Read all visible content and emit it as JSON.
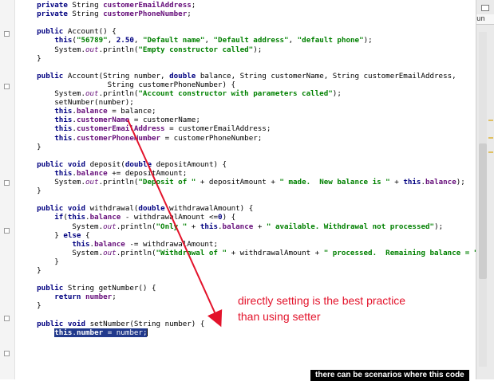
{
  "editor": {
    "lines": [
      [
        {
          "t": "    "
        },
        {
          "t": "private",
          "c": "k"
        },
        {
          "t": " String "
        },
        {
          "t": "customerEmailAddress",
          "c": "f"
        },
        {
          "t": ";"
        }
      ],
      [
        {
          "t": "    "
        },
        {
          "t": "private",
          "c": "k"
        },
        {
          "t": " String "
        },
        {
          "t": "customerPhoneNumber",
          "c": "f"
        },
        {
          "t": ";"
        }
      ],
      [],
      [
        {
          "t": "    "
        },
        {
          "t": "public",
          "c": "k"
        },
        {
          "t": " Account() {"
        }
      ],
      [
        {
          "t": "        "
        },
        {
          "t": "this",
          "c": "k"
        },
        {
          "t": "("
        },
        {
          "t": "\"56789\"",
          "c": "s"
        },
        {
          "t": ", "
        },
        {
          "t": "2.50",
          "c": "k"
        },
        {
          "t": ", "
        },
        {
          "t": "\"Default name\"",
          "c": "s"
        },
        {
          "t": ", "
        },
        {
          "t": "\"Default address\"",
          "c": "s"
        },
        {
          "t": ", "
        },
        {
          "t": "\"default phone\"",
          "c": "s"
        },
        {
          "t": ");"
        }
      ],
      [
        {
          "t": "        System."
        },
        {
          "t": "out",
          "c": "i"
        },
        {
          "t": ".println("
        },
        {
          "t": "\"Empty constructor called\"",
          "c": "s"
        },
        {
          "t": ");"
        }
      ],
      [
        {
          "t": "    }"
        }
      ],
      [],
      [
        {
          "t": "    "
        },
        {
          "t": "public",
          "c": "k"
        },
        {
          "t": " Account(String number, "
        },
        {
          "t": "double",
          "c": "k"
        },
        {
          "t": " balance, String customerName, String customerEmailAddress,"
        }
      ],
      [
        {
          "t": "                    String customerPhoneNumber) {"
        }
      ],
      [
        {
          "t": "        System."
        },
        {
          "t": "out",
          "c": "i"
        },
        {
          "t": ".println("
        },
        {
          "t": "\"Account constructor with parameters called\"",
          "c": "s"
        },
        {
          "t": ");"
        }
      ],
      [
        {
          "t": "        setNumber(number);"
        }
      ],
      [
        {
          "t": "        "
        },
        {
          "t": "this",
          "c": "k"
        },
        {
          "t": "."
        },
        {
          "t": "balance",
          "c": "f"
        },
        {
          "t": " = balance;"
        }
      ],
      [
        {
          "t": "        "
        },
        {
          "t": "this",
          "c": "k"
        },
        {
          "t": "."
        },
        {
          "t": "customerName",
          "c": "f"
        },
        {
          "t": " = customerName;"
        }
      ],
      [
        {
          "t": "        "
        },
        {
          "t": "this",
          "c": "k"
        },
        {
          "t": "."
        },
        {
          "t": "customerEmailAddress",
          "c": "f"
        },
        {
          "t": " = customerEmailAddress;"
        }
      ],
      [
        {
          "t": "        "
        },
        {
          "t": "this",
          "c": "k"
        },
        {
          "t": "."
        },
        {
          "t": "customerPhoneNumber",
          "c": "f"
        },
        {
          "t": " = customerPhoneNumber;"
        }
      ],
      [
        {
          "t": "    }"
        }
      ],
      [],
      [
        {
          "t": "    "
        },
        {
          "t": "public",
          "c": "k"
        },
        {
          "t": " "
        },
        {
          "t": "void",
          "c": "k"
        },
        {
          "t": " deposit("
        },
        {
          "t": "double",
          "c": "k"
        },
        {
          "t": " depositAmount) {"
        }
      ],
      [
        {
          "t": "        "
        },
        {
          "t": "this",
          "c": "k"
        },
        {
          "t": "."
        },
        {
          "t": "balance",
          "c": "f"
        },
        {
          "t": " += depositAmount;"
        }
      ],
      [
        {
          "t": "        System."
        },
        {
          "t": "out",
          "c": "i"
        },
        {
          "t": ".println("
        },
        {
          "t": "\"Deposit of \"",
          "c": "s"
        },
        {
          "t": " + depositAmount + "
        },
        {
          "t": "\" made.  New balance is \"",
          "c": "s"
        },
        {
          "t": " + "
        },
        {
          "t": "this",
          "c": "k"
        },
        {
          "t": "."
        },
        {
          "t": "balance",
          "c": "f"
        },
        {
          "t": ");"
        }
      ],
      [
        {
          "t": "    }"
        }
      ],
      [],
      [
        {
          "t": "    "
        },
        {
          "t": "public",
          "c": "k"
        },
        {
          "t": " "
        },
        {
          "t": "void",
          "c": "k"
        },
        {
          "t": " withdrawal("
        },
        {
          "t": "double",
          "c": "k"
        },
        {
          "t": " withdrawalAmount) {"
        }
      ],
      [
        {
          "t": "        "
        },
        {
          "t": "if",
          "c": "k"
        },
        {
          "t": "("
        },
        {
          "t": "this",
          "c": "k"
        },
        {
          "t": "."
        },
        {
          "t": "balance",
          "c": "f"
        },
        {
          "t": " - withdrawalAmount <="
        },
        {
          "t": "0",
          "c": "k"
        },
        {
          "t": ") {"
        }
      ],
      [
        {
          "t": "            System."
        },
        {
          "t": "out",
          "c": "i"
        },
        {
          "t": ".println("
        },
        {
          "t": "\"Only \"",
          "c": "s"
        },
        {
          "t": " + "
        },
        {
          "t": "this",
          "c": "k"
        },
        {
          "t": "."
        },
        {
          "t": "balance",
          "c": "f"
        },
        {
          "t": " + "
        },
        {
          "t": "\" available. Withdrawal not processed\"",
          "c": "s"
        },
        {
          "t": ");"
        }
      ],
      [
        {
          "t": "        } "
        },
        {
          "t": "else",
          "c": "k"
        },
        {
          "t": " {"
        }
      ],
      [
        {
          "t": "            "
        },
        {
          "t": "this",
          "c": "k"
        },
        {
          "t": "."
        },
        {
          "t": "balance",
          "c": "f"
        },
        {
          "t": " -= withdrawalAmount;"
        }
      ],
      [
        {
          "t": "            System."
        },
        {
          "t": "out",
          "c": "i"
        },
        {
          "t": ".println("
        },
        {
          "t": "\"Withdrawal of \"",
          "c": "s"
        },
        {
          "t": " + withdrawalAmount + "
        },
        {
          "t": "\" processed.  Remaining balance = \"",
          "c": "s"
        },
        {
          "t": " + "
        }
      ],
      [
        {
          "t": "        }"
        }
      ],
      [
        {
          "t": "    }"
        }
      ],
      [],
      [
        {
          "t": "    "
        },
        {
          "t": "public",
          "c": "k"
        },
        {
          "t": " String getNumber() {"
        }
      ],
      [
        {
          "t": "        "
        },
        {
          "t": "return",
          "c": "k"
        },
        {
          "t": " "
        },
        {
          "t": "number",
          "c": "f"
        },
        {
          "t": ";"
        }
      ],
      [
        {
          "t": "    }"
        }
      ],
      [],
      [
        {
          "t": "    "
        },
        {
          "t": "public",
          "c": "k"
        },
        {
          "t": " "
        },
        {
          "t": "void",
          "c": "k"
        },
        {
          "t": " setNumber(String number) {"
        }
      ],
      [
        {
          "t": "        "
        },
        {
          "t": "this",
          "c": "k",
          "hl": true
        },
        {
          "t": ".",
          "hl": true
        },
        {
          "t": "number",
          "c": "f",
          "hl": true
        },
        {
          "t": " = number;",
          "hl": true
        }
      ]
    ],
    "caret_line": 37
  },
  "annotation": {
    "line1": "directly setting is the best practice",
    "line2": "than using setter",
    "color": "#e3132b"
  },
  "right_panel": {
    "tab_label": "un"
  },
  "subtitle": {
    "text": "there can be scenarios where this code"
  }
}
